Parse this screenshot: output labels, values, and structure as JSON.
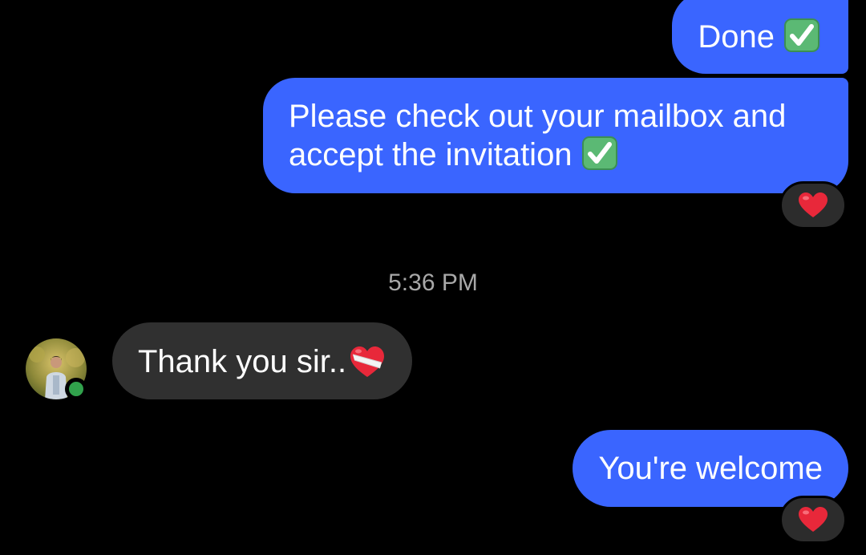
{
  "colors": {
    "outgoing_bubble": "#3a65ff",
    "incoming_bubble": "#303030",
    "reaction_bg": "#2c2c2c",
    "timestamp_text": "#a8a8a8",
    "online_status": "#31a24c"
  },
  "messages": [
    {
      "direction": "outgoing",
      "text": "Done",
      "trailing_icon": "check-mark-button-icon",
      "reaction": null
    },
    {
      "direction": "outgoing",
      "text": "Please check out your mailbox and accept the invitation",
      "trailing_icon": "check-mark-button-icon",
      "reaction": "red-heart-icon"
    },
    {
      "direction": "incoming",
      "text": "Thank you sir..",
      "trailing_icon": "mending-heart-icon",
      "reaction": null
    },
    {
      "direction": "outgoing",
      "text": "You're welcome",
      "trailing_icon": null,
      "reaction": "red-heart-icon"
    }
  ],
  "timestamp": "5:36 PM",
  "contact": {
    "avatar_icon": "avatar",
    "online": true
  }
}
